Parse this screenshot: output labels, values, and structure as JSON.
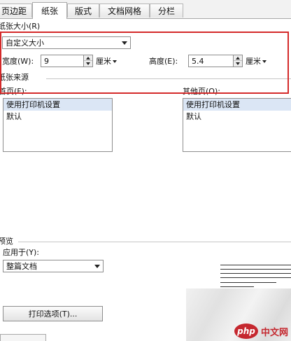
{
  "tabs": [
    {
      "label": "页边距"
    },
    {
      "label": "纸张",
      "active": true
    },
    {
      "label": "版式"
    },
    {
      "label": "文档网格"
    },
    {
      "label": "分栏"
    }
  ],
  "paper_size": {
    "section_label": "纸张大小(R)",
    "selected": "自定义大小",
    "width": {
      "label": "宽度(W):",
      "value": "9",
      "unit": "厘米"
    },
    "height": {
      "label": "高度(E):",
      "value": "5.4",
      "unit": "厘米"
    }
  },
  "paper_source": {
    "section_label": "纸张来源",
    "first_page": {
      "label": "首页(F):",
      "items": [
        "使用打印机设置",
        "默认"
      ]
    },
    "other_pages": {
      "label": "其他页(O):",
      "items": [
        "使用打印机设置",
        "默认"
      ]
    }
  },
  "preview": {
    "section_label": "预览",
    "apply_to_label": "应用于(Y):",
    "apply_to_value": "整篇文档"
  },
  "print_options_label": "打印选项(T)...",
  "watermark": {
    "badge": "php",
    "text": "中文网"
  },
  "colors": {
    "highlight": "#d42a2a",
    "selection": "#dbe6f5"
  }
}
